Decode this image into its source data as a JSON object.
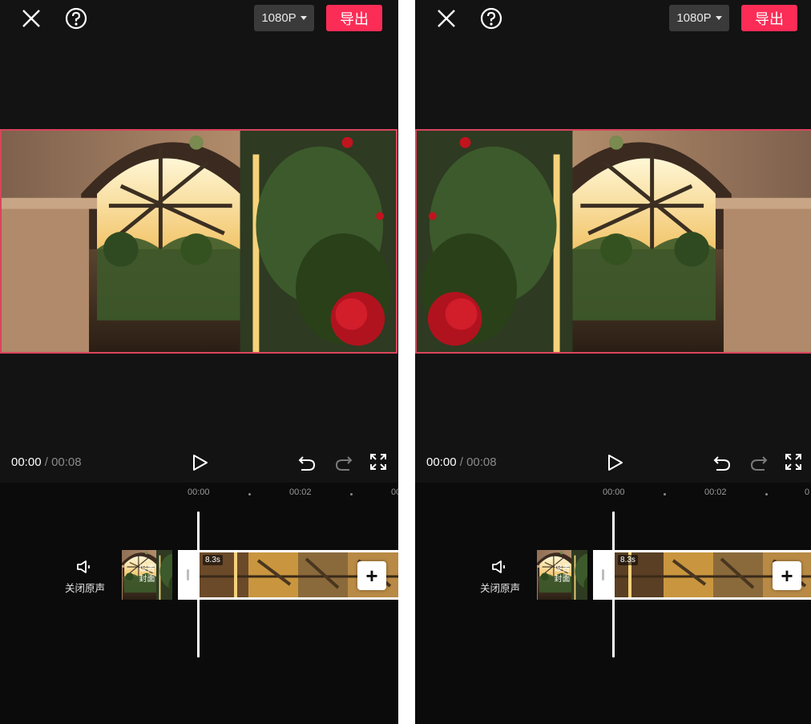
{
  "screens": [
    {
      "top": {
        "resolution": "1080P",
        "export_label": "导出"
      },
      "player": {
        "current": "00:00",
        "separator": "/",
        "total": "00:08"
      },
      "ruler": {
        "t0": "00:00",
        "t1": "00:02",
        "t2": "00"
      },
      "track": {
        "mute_label": "关闭原声",
        "cover_line1": "设置",
        "cover_line2": "封面",
        "duration": "8.3s"
      }
    },
    {
      "top": {
        "resolution": "1080P",
        "export_label": "导出"
      },
      "player": {
        "current": "00:00",
        "separator": "/",
        "total": "00:08"
      },
      "ruler": {
        "t0": "00:00",
        "t1": "00:02",
        "t2": "0"
      },
      "track": {
        "mute_label": "关闭原声",
        "cover_line1": "设置",
        "cover_line2": "封面",
        "duration": "8.3s"
      }
    }
  ],
  "colors": {
    "accent": "#fb2c56",
    "frame_border": "#d9455c",
    "background": "#131313"
  },
  "icons": [
    "close-icon",
    "help-icon",
    "caret-down-icon",
    "play-icon",
    "undo-icon",
    "redo-icon",
    "fullscreen-icon",
    "speaker-icon",
    "plus-icon"
  ]
}
